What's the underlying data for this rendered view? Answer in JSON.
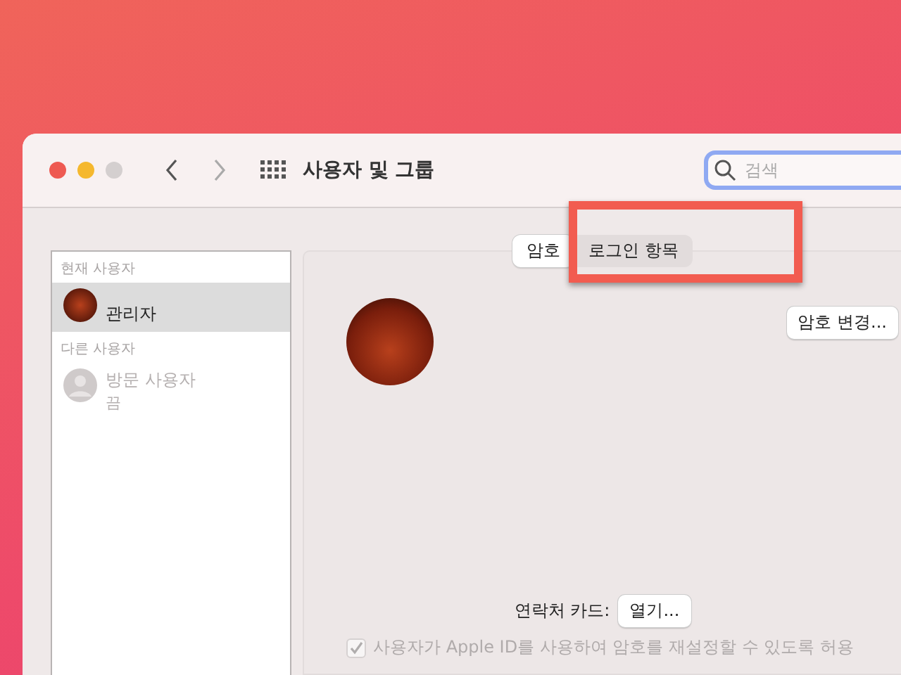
{
  "window": {
    "title": "사용자 및 그룹"
  },
  "search": {
    "placeholder": "검색"
  },
  "sidebar": {
    "sections": [
      {
        "heading": "현재 사용자",
        "users": [
          {
            "name": "관리자",
            "selected": true,
            "kind": "photo"
          }
        ]
      },
      {
        "heading": "다른 사용자",
        "users": [
          {
            "name": "방문 사용자",
            "status": "끔",
            "selected": false,
            "kind": "generic"
          }
        ]
      }
    ]
  },
  "tabs": [
    {
      "label": "암호",
      "selected": true
    },
    {
      "label": "로그인 항목",
      "selected": false
    }
  ],
  "change_password_button": "암호 변경...",
  "contact_card": {
    "label": "연락처 카드:",
    "button": "열기..."
  },
  "apple_id_reset": {
    "label": "사용자가 Apple ID를 사용하여 암호를 재설정할 수 있도록 허용",
    "checked": true,
    "disabled": true
  }
}
